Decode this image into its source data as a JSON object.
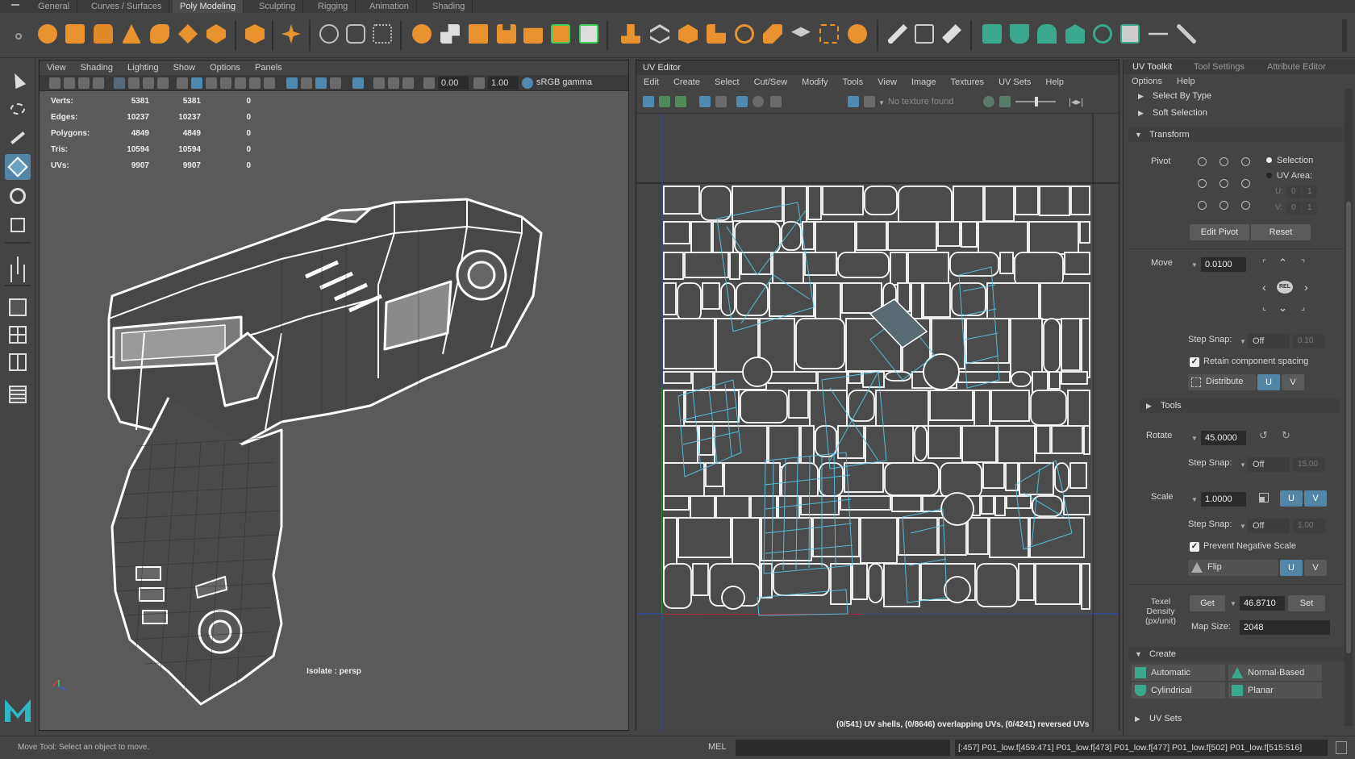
{
  "shelf_tabs": [
    "General",
    "Curves / Surfaces",
    "Poly Modeling",
    "Sculpting",
    "Rigging",
    "Animation",
    "Shading"
  ],
  "shelf_active": "Poly Modeling",
  "viewport": {
    "menu": [
      "View",
      "Shading",
      "Lighting",
      "Show",
      "Options",
      "Panels"
    ],
    "exposure": "0.00",
    "gamma": "1.00",
    "colorspace": "sRGB gamma",
    "hud": [
      {
        "label": "Verts:",
        "a": "5381",
        "b": "5381",
        "c": "0"
      },
      {
        "label": "Edges:",
        "a": "10237",
        "b": "10237",
        "c": "0"
      },
      {
        "label": "Polygons:",
        "a": "4849",
        "b": "4849",
        "c": "0"
      },
      {
        "label": "Tris:",
        "a": "10594",
        "b": "10594",
        "c": "0"
      },
      {
        "label": "UVs:",
        "a": "9907",
        "b": "9907",
        "c": "0"
      }
    ],
    "camera_label": "Isolate : persp"
  },
  "uv_editor": {
    "title": "UV Editor",
    "menu": [
      "Edit",
      "Create",
      "Select",
      "Cut/Sew",
      "Modify",
      "Tools",
      "View",
      "Image",
      "Textures",
      "UV Sets",
      "Help"
    ],
    "no_texture": "No texture found",
    "info": "(0/541) UV shells, (0/8646) overlapping UVs, (0/4241) reversed UVs"
  },
  "toolkit": {
    "tabs": [
      "UV Toolkit",
      "Tool Settings",
      "Attribute Editor"
    ],
    "menu": [
      "Options",
      "Help"
    ],
    "select_by_type": "Select By Type",
    "soft_selection": "Soft Selection",
    "transform": "Transform",
    "pivot": "Pivot",
    "selection": "Selection",
    "uv_area": "UV Area:",
    "u_label": "U:",
    "v_label": "V:",
    "pivot_u": "0",
    "pivot_v": "0",
    "pivot_u2": "1",
    "pivot_v2": "1",
    "edit_pivot": "Edit Pivot",
    "reset": "Reset",
    "move": "Move",
    "move_value": "0.0100",
    "rel": "REL",
    "step_snap": "Step Snap:",
    "off": "Off",
    "move_snap_value": "0.10",
    "retain_spacing": "Retain component spacing",
    "distribute": "Distribute",
    "u": "U",
    "v": "V",
    "tools": "Tools",
    "rotate": "Rotate",
    "rotate_value": "45.0000",
    "rotate_snap_value": "15.00",
    "scale": "Scale",
    "scale_value": "1.0000",
    "scale_snap_value": "1.00",
    "prevent_negative": "Prevent Negative Scale",
    "flip": "Flip",
    "texel_density": "Texel Density (px/unit)",
    "get": "Get",
    "td_value": "46.8710",
    "set": "Set",
    "map_size": "Map Size:",
    "map_size_value": "2048",
    "create": "Create",
    "automatic": "Automatic",
    "normal_based": "Normal-Based",
    "cylindrical": "Cylindrical",
    "planar": "Planar",
    "uv_sets": "UV Sets"
  },
  "status": {
    "help": "Move Tool: Select an object to move.",
    "mel": "MEL",
    "output": "[:457] P01_low.f[459:471] P01_low.f[473] P01_low.f[477] P01_low.f[502] P01_low.f[515:516]"
  },
  "colors": {
    "accent": "#5285a6",
    "shelf_orange": "#e8932f",
    "wire": "#ffffff",
    "uv_blue": "#5bc8e8"
  }
}
